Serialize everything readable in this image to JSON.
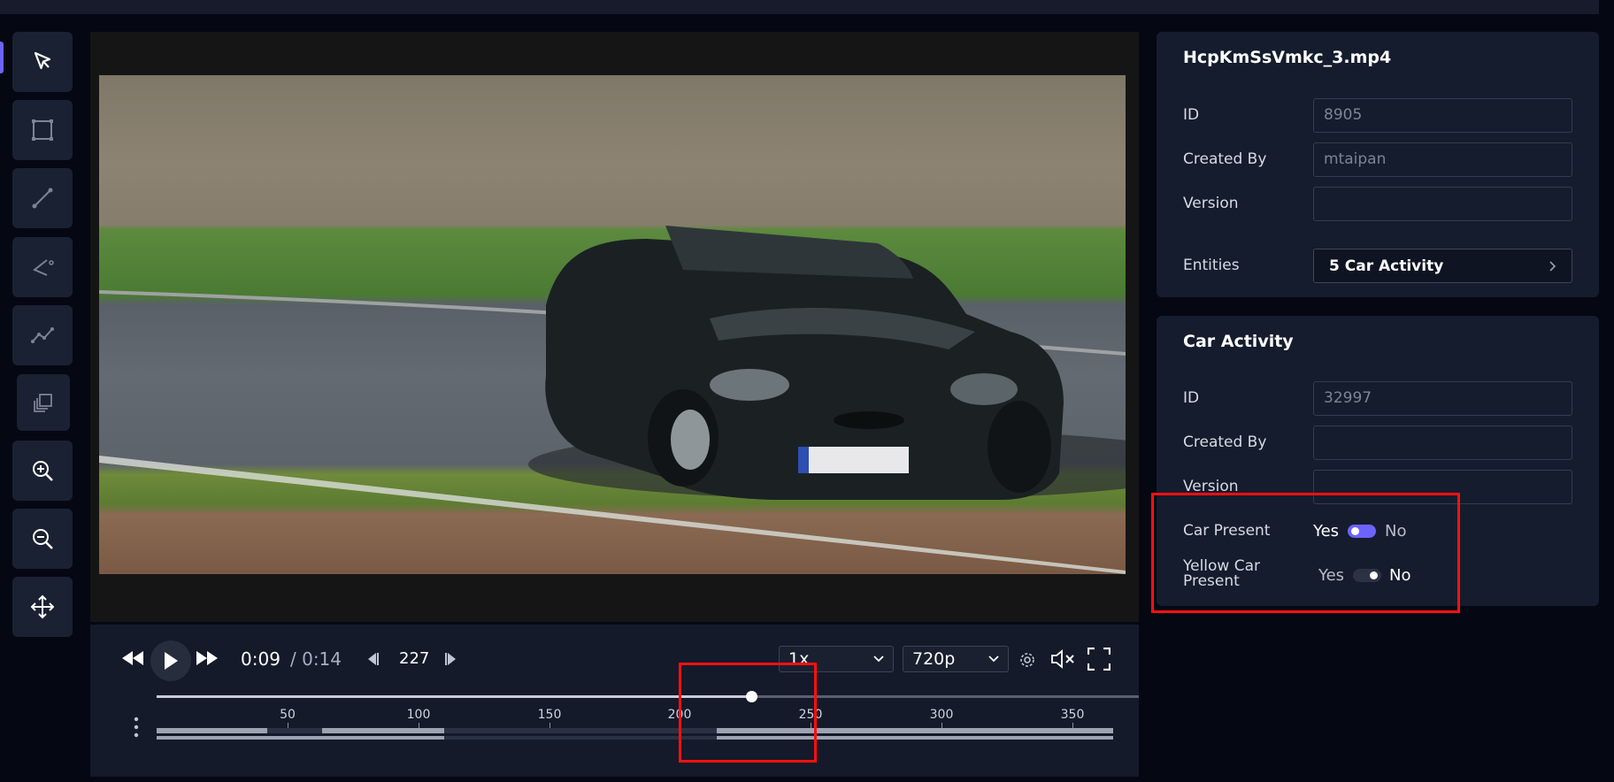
{
  "sidebar": {
    "tools": [
      {
        "name": "select-tool",
        "icon": "cursor-icon"
      },
      {
        "name": "bounding-box-tool",
        "icon": "bounding-box-icon"
      },
      {
        "name": "line-tool",
        "icon": "line-icon"
      },
      {
        "name": "angle-tool",
        "icon": "angle-icon"
      },
      {
        "name": "polyline-tool",
        "icon": "polyline-icon"
      },
      {
        "name": "layers-tool",
        "icon": "layers-icon"
      },
      {
        "name": "zoom-in-tool",
        "icon": "zoom-in-icon"
      },
      {
        "name": "zoom-out-tool",
        "icon": "zoom-out-icon"
      },
      {
        "name": "pan-tool",
        "icon": "move-icon"
      }
    ]
  },
  "player": {
    "current_time": "0:09",
    "total_time": "/ 0:14",
    "frame": "227",
    "speed": "1x",
    "quality": "720p",
    "progress": 0.605,
    "ticks": [
      "50",
      "100",
      "150",
      "200",
      "250",
      "300",
      "350"
    ]
  },
  "file_panel": {
    "title": "HcpKmSsVmkc_3.mp4",
    "id_label": "ID",
    "id_value": "8905",
    "created_by_label": "Created By",
    "created_by_value": "mtaipan",
    "version_label": "Version",
    "version_value": "",
    "entities_label": "Entities",
    "entities_value": "5 Car Activity"
  },
  "activity_panel": {
    "title": "Car Activity",
    "id_label": "ID",
    "id_value": "32997",
    "created_by_label": "Created By",
    "created_by_value": "",
    "version_label": "Version",
    "version_value": "",
    "car_present_label": "Car Present",
    "car_present_yes": "Yes",
    "car_present_no": "No",
    "car_present_value": "Yes",
    "yellow_car_label_line1": "Yellow Car",
    "yellow_car_label_line2": "Present",
    "yellow_car_yes": "Yes",
    "yellow_car_no": "No",
    "yellow_car_value": "No"
  },
  "colors": {
    "accent": "#6c63ff",
    "highlight": "#ff1010",
    "panel": "#151c2d"
  }
}
